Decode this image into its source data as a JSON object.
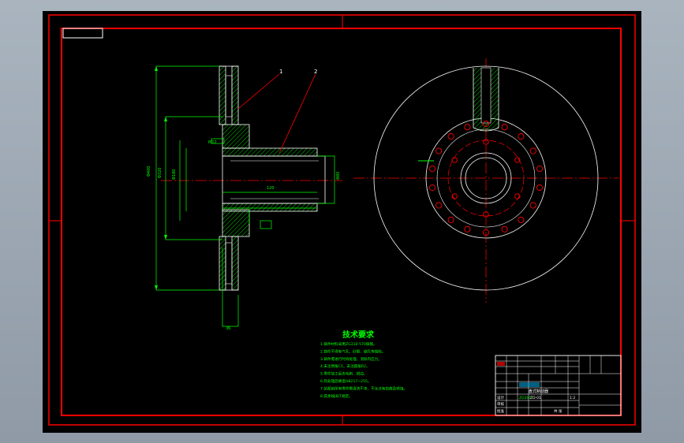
{
  "viewport": {
    "background": "#000000",
    "frame_color": "#ff0000"
  },
  "colors": {
    "outline": "#ffffff",
    "dimension": "#00ff00",
    "center_line": "#ff0000",
    "hatch": "#00ff00",
    "frame": "#ff0000"
  },
  "section_view": {
    "leader_tag_1": "1",
    "leader_tag_2": "2"
  },
  "tech_requirements": {
    "title": "技术要求",
    "lines": [
      "1.铸件材料采用ZG310-570铸钢。",
      "2.铸件不得有气孔、砂眼、缩孔等缺陷。",
      "3.铸件需进行时效处理，消除内应力。",
      "4.未注倒角C1，未注圆角R2。",
      "5.零件加工后去毛刺、锐边。",
      "6.热处理后硬度HB217~255。",
      "7.装配前所有零件需清洗干净，不允许有划痕及锈蚀。",
      "8.其余按JB/T规定。"
    ]
  },
  "title_block": {
    "part_name": "盘式制动器",
    "drawing_no": "ZD-01",
    "material": "ZG310",
    "scale": "1:2",
    "design": "设计",
    "check": "审核",
    "approve": "批准",
    "sheet": "共 张"
  }
}
